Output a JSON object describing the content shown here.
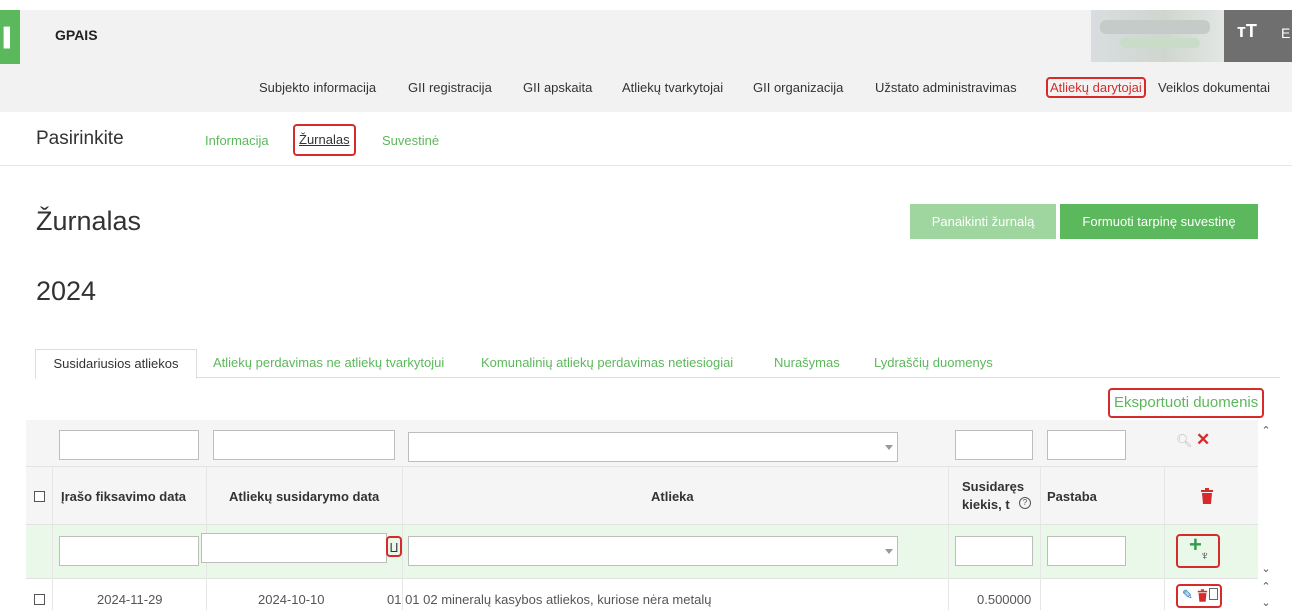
{
  "app": {
    "logo": "▌",
    "title": "GPAIS",
    "font_icon": "тT",
    "extra": "E"
  },
  "colors": {
    "accent": "#5cb85c",
    "accent_light": "#9fd59f",
    "danger": "#d62b2b",
    "header_bg": "#f2f2f2"
  },
  "main_nav": [
    {
      "label": "Subjekto informacija",
      "highlighted": false
    },
    {
      "label": "GII registracija",
      "highlighted": false
    },
    {
      "label": "GII apskaita",
      "highlighted": false
    },
    {
      "label": "Atliekų tvarkytojai",
      "highlighted": false
    },
    {
      "label": "GII organizacija",
      "highlighted": false
    },
    {
      "label": "Užstato administravimas",
      "highlighted": false
    },
    {
      "label": "Atliekų darytojai",
      "highlighted": true
    },
    {
      "label": "Veiklos dokumentai",
      "highlighted": false
    }
  ],
  "subnav": {
    "title": "Pasirinkite",
    "items": [
      {
        "label": "Informacija",
        "active": false
      },
      {
        "label": "Žurnalas",
        "active": true
      },
      {
        "label": "Suvestinė",
        "active": false
      }
    ]
  },
  "page": {
    "title": "Žurnalas",
    "year": "2024"
  },
  "actions": {
    "delete_journal": "Panaikinti žurnalą",
    "form_summary": "Formuoti tarpinę suvestinę",
    "export": "Eksportuoti duomenis"
  },
  "tabs": [
    {
      "label": "Susidariusios atliekos",
      "active": true
    },
    {
      "label": "Atliekų perdavimas ne atliekų tvarkytojui",
      "active": false
    },
    {
      "label": "Komunalinių atliekų perdavimas netiesiogiai",
      "active": false
    },
    {
      "label": "Nurašymas",
      "active": false
    },
    {
      "label": "Lydraščių duomenys",
      "active": false
    }
  ],
  "table": {
    "columns": [
      "Įrašo fiksavimo data",
      "Atliekų susidarymo data",
      "Atlieka",
      "Susidaręs",
      "kiekis, t",
      "Pastaba"
    ],
    "help_icon": "?",
    "icons": {
      "search": "search-icon",
      "clear": "close-icon",
      "delete": "trash-icon",
      "add": "plus-icon",
      "pick": "broom-icon",
      "edit": "pencil-icon",
      "copy": "copy-icon",
      "date": "calendar-icon"
    },
    "rows": [
      {
        "record_date": "2024-11-29",
        "created_date": "2024-10-10",
        "waste": "01 01 02 mineralų kasybos atliekos, kuriose nėra metalų",
        "quantity": "0.500000",
        "note": ""
      }
    ]
  }
}
